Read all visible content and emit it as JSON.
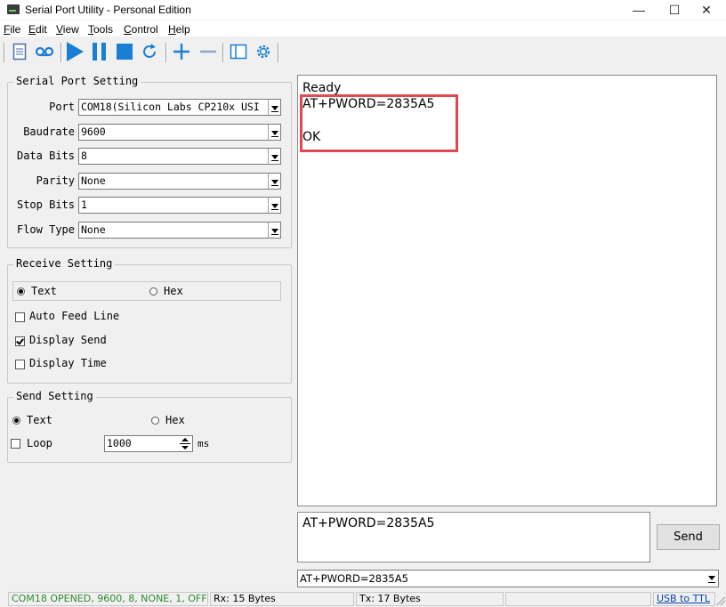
{
  "window": {
    "title": "Serial Port Utility - Personal Edition",
    "controls": {
      "minimize": "—",
      "maximize": "☐",
      "close": "✕"
    }
  },
  "menu": [
    {
      "label": "File",
      "key": "F",
      "rest": "ile"
    },
    {
      "label": "Edit",
      "key": "E",
      "rest": "dit"
    },
    {
      "label": "View",
      "key": "V",
      "rest": "iew"
    },
    {
      "label": "Tools",
      "key": "T",
      "rest": "ools"
    },
    {
      "label": "Control",
      "key": "C",
      "rest": "ontrol"
    },
    {
      "label": "Help",
      "key": "H",
      "rest": "elp"
    }
  ],
  "toolbar": {
    "icons": [
      "document-icon",
      "record-icon",
      "play-icon",
      "pause-icon",
      "stop-icon",
      "refresh-icon",
      "add-icon",
      "remove-icon",
      "window-icon",
      "settings-icon"
    ],
    "accent": "#1a7fd4"
  },
  "serial_port_setting": {
    "title": "Serial Port Setting",
    "fields": [
      {
        "label": "Port",
        "value": "COM18(Silicon Labs CP210x USI"
      },
      {
        "label": "Baudrate",
        "value": "9600"
      },
      {
        "label": "Data Bits",
        "value": "8"
      },
      {
        "label": "Parity",
        "value": "None"
      },
      {
        "label": "Stop Bits",
        "value": "1"
      },
      {
        "label": "Flow Type",
        "value": "None"
      }
    ]
  },
  "receive_setting": {
    "title": "Receive Setting",
    "text_label": "Text",
    "hex_label": "Hex",
    "mode": "Text",
    "auto_feed_line": {
      "label": "Auto Feed Line",
      "checked": false
    },
    "display_send": {
      "label": "Display Send",
      "checked": true
    },
    "display_time": {
      "label": "Display Time",
      "checked": false
    }
  },
  "send_setting": {
    "title": "Send Setting",
    "text_label": "Text",
    "hex_label": "Hex",
    "mode": "Text",
    "loop": {
      "label": "Loop",
      "checked": false
    },
    "interval": "1000",
    "unit": "ms"
  },
  "receive_area": {
    "lines": [
      "Ready",
      "AT+PWORD=2835A5",
      "OK"
    ],
    "highlight_color": "#e0494d"
  },
  "send_area": {
    "text": "AT+PWORD=2835A5",
    "send_button": "Send",
    "history_value": "AT+PWORD=2835A5"
  },
  "status_bar": {
    "connection": "COM18 OPENED, 9600, 8, NONE, 1, OFF",
    "rx": "Rx: 15 Bytes",
    "tx": "Tx: 17 Bytes",
    "link": "USB to TTL",
    "connection_color": "#2e8b2e",
    "link_color": "#0645ad"
  }
}
